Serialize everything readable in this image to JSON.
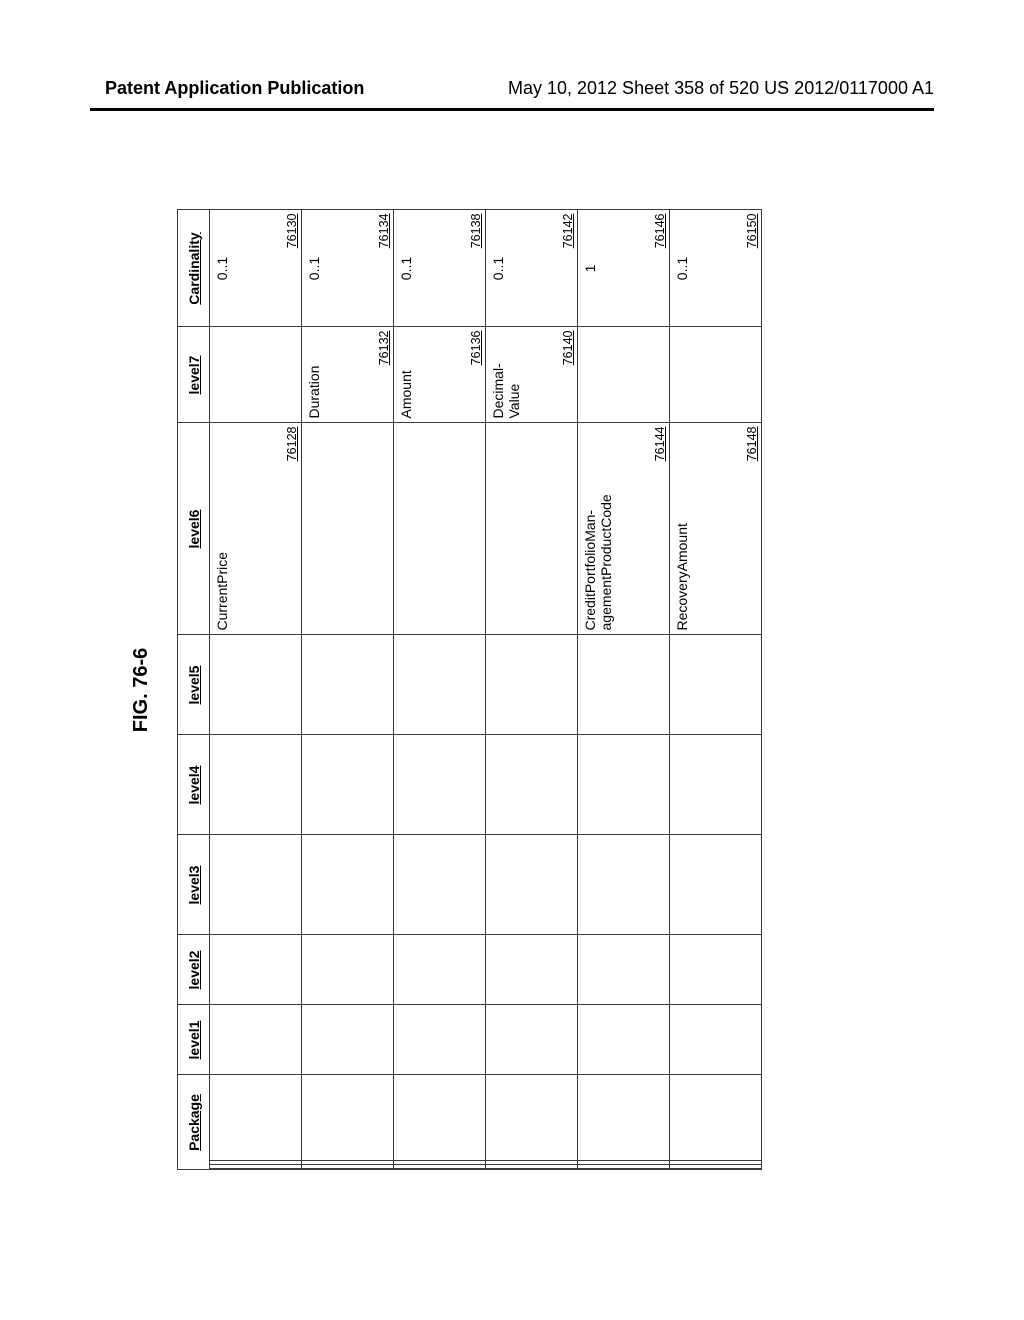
{
  "header": {
    "left": "Patent Application Publication",
    "right": "May 10, 2012  Sheet 358 of 520   US 2012/0117000 A1"
  },
  "figure_label": "FIG. 76-6",
  "columns": {
    "package": "Package",
    "l1": "level1",
    "l2": "level2",
    "l3": "level3",
    "l4": "level4",
    "l5": "level5",
    "l6": "level6",
    "l7": "level7",
    "card": "Cardinality"
  },
  "rows": [
    {
      "l6": "CurrentPrice",
      "l6_ref": "76128",
      "l7": "",
      "l7_ref": "",
      "card": "0..1",
      "card_ref": "76130"
    },
    {
      "l6": "",
      "l6_ref": "",
      "l7": "Duration",
      "l7_ref": "76132",
      "card": "0..1",
      "card_ref": "76134"
    },
    {
      "l6": "",
      "l6_ref": "",
      "l7": "Amount",
      "l7_ref": "76136",
      "card": "0..1",
      "card_ref": "76138"
    },
    {
      "l6": "",
      "l6_ref": "",
      "l7": "Decimal-\nValue",
      "l7_ref": "76140",
      "card": "0..1",
      "card_ref": "76142"
    },
    {
      "l6": "CreditPortfolioMan-\nagementProductCode",
      "l6_ref": "76144",
      "l7": "",
      "l7_ref": "",
      "card": "1",
      "card_ref": "76146"
    },
    {
      "l6": "RecoveryAmount",
      "l6_ref": "76148",
      "l7": "",
      "l7_ref": "",
      "card": "0..1",
      "card_ref": "76150"
    }
  ]
}
